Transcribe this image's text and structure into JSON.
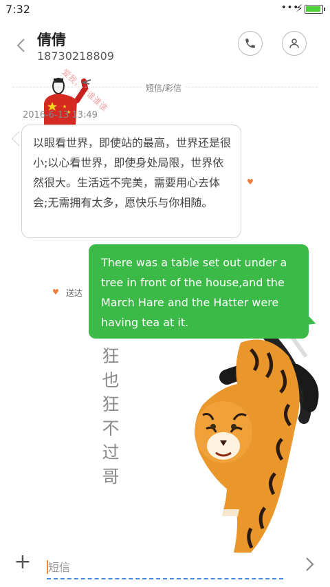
{
  "status_bar": {
    "time": "7:32",
    "dots": "•••",
    "bolt": "⚡",
    "battery_color": "#4fd13a"
  },
  "header": {
    "contact_name": "倩倩",
    "phone_number": "18730218809",
    "back_icon": "chevron-left-icon",
    "call_icon": "phone-icon",
    "contact_icon": "person-icon"
  },
  "watermark": "爱我，爱谁谁谁",
  "divider_label": "短信/彩信",
  "thread": {
    "timestamp": "2016-6-13 13:49",
    "incoming_message": "以眼看世界，即使站的最高，世界还是很小;以心看世界，即使身处局限，世界依然很大。生活远不完美，需要用心去体会;无需拥有太多，愿快乐与你相随。",
    "heart_icon": "♥",
    "outgoing_message": "There was a table set out under a tree in front of the house,and the March Hare and the Hatter were having tea at it.",
    "delivered_label": "送达",
    "bubble_color": "#3bba47"
  },
  "background_slogan": [
    "狂",
    "也",
    "狂",
    "不",
    "过",
    "哥"
  ],
  "compose": {
    "add_label": "+",
    "placeholder": "短信",
    "send_icon": "chevron-right-icon"
  }
}
